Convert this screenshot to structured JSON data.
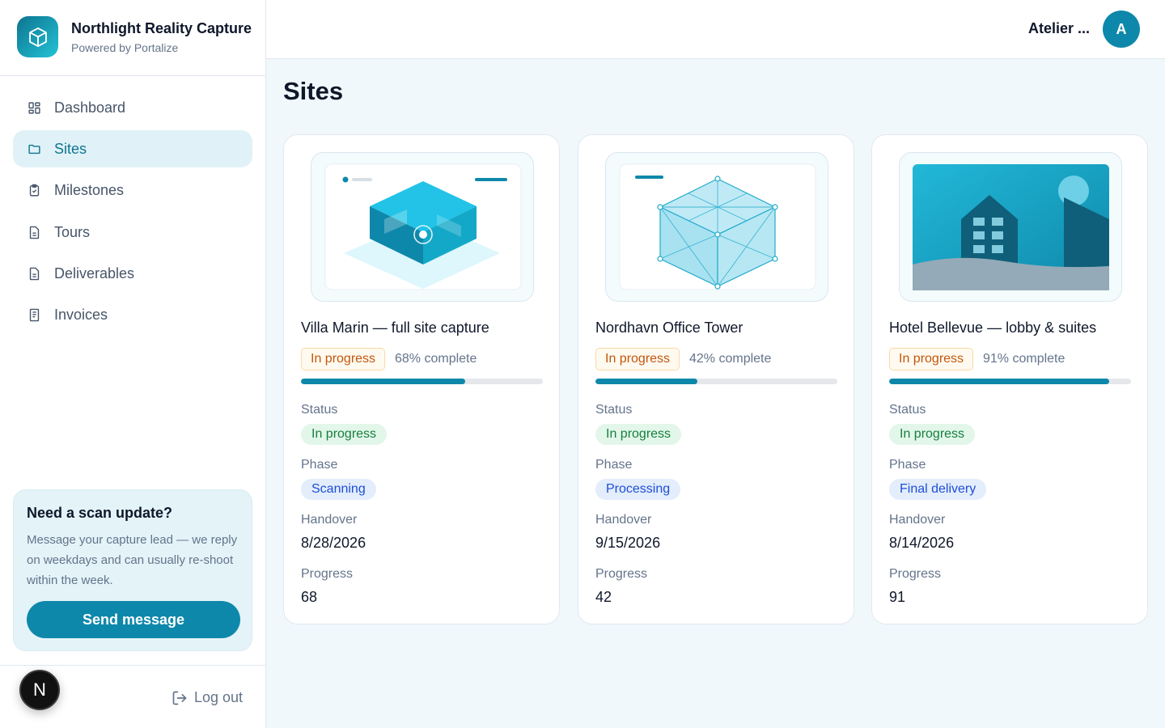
{
  "brand": {
    "name": "Northlight Reality Capture",
    "subtitle": "Powered by Portalize"
  },
  "nav": {
    "items": [
      {
        "label": "Dashboard",
        "icon": "grid-icon"
      },
      {
        "label": "Sites",
        "icon": "folder-icon",
        "active": true
      },
      {
        "label": "Milestones",
        "icon": "clipboard-icon"
      },
      {
        "label": "Tours",
        "icon": "file-icon"
      },
      {
        "label": "Deliverables",
        "icon": "document-icon"
      },
      {
        "label": "Invoices",
        "icon": "receipt-icon"
      }
    ]
  },
  "help": {
    "title": "Need a scan update?",
    "text": "Message your capture lead — we reply on weekdays and can usually re-shoot within the week.",
    "button": "Send message"
  },
  "footer": {
    "user_initial": "N",
    "logout": "Log out"
  },
  "topbar": {
    "account_name": "Atelier ...",
    "avatar_initial": "A"
  },
  "page": {
    "title": "Sites"
  },
  "labels": {
    "status": "Status",
    "phase": "Phase",
    "handover": "Handover",
    "progress": "Progress"
  },
  "sites": [
    {
      "title": "Villa Marin — full site capture",
      "badge": "In progress",
      "complete": "68% complete",
      "progress": 68,
      "status": "In progress",
      "phase": "Scanning",
      "handover": "8/28/2026",
      "progress_value": "68"
    },
    {
      "title": "Nordhavn Office Tower",
      "badge": "In progress",
      "complete": "42% complete",
      "progress": 42,
      "status": "In progress",
      "phase": "Processing",
      "handover": "9/15/2026",
      "progress_value": "42"
    },
    {
      "title": "Hotel Bellevue — lobby & suites",
      "badge": "In progress",
      "complete": "91% complete",
      "progress": 91,
      "status": "In progress",
      "phase": "Final delivery",
      "handover": "8/14/2026",
      "progress_value": "91"
    }
  ],
  "colors": {
    "accent": "#0e88aa",
    "active_nav_bg": "#e0f2f7",
    "warning": "#c2570c",
    "success": "#15803d",
    "info": "#1d4ed8"
  }
}
